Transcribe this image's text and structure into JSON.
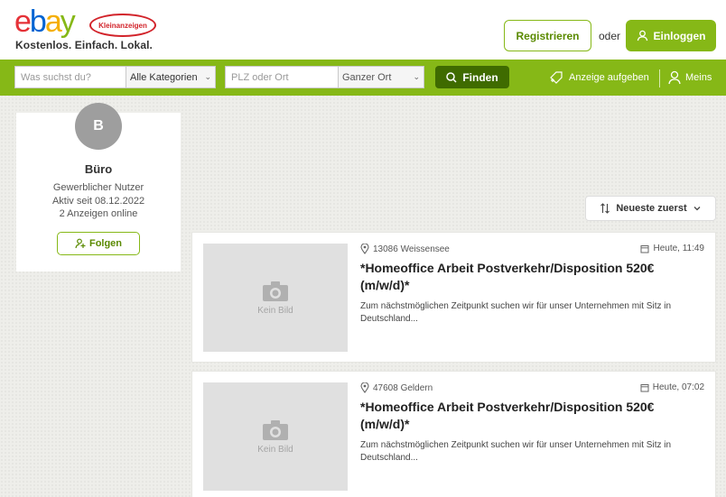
{
  "brand": {
    "logo_letters": [
      "e",
      "b",
      "a",
      "y"
    ],
    "badge": "Kleinanzeigen",
    "tagline": "Kostenlos. Einfach. Lokal.",
    "colors": {
      "accent": "#86b817",
      "accent_dark": "#3f6b00",
      "logo_red": "#e53238"
    }
  },
  "header": {
    "register_label": "Registrieren",
    "or_label": "oder",
    "login_label": "Einloggen"
  },
  "search": {
    "query_placeholder": "Was suchst du?",
    "category_value": "Alle Kategorien",
    "location_placeholder": "PLZ oder Ort",
    "radius_value": "Ganzer Ort",
    "find_label": "Finden",
    "post_ad_label": "Anzeige aufgeben",
    "mine_label": "Meins"
  },
  "profile": {
    "initial": "B",
    "name": "Büro",
    "type": "Gewerblicher Nutzer",
    "active_since": "Aktiv seit 08.12.2022",
    "ads_online": "2 Anzeigen online",
    "follow_label": "Folgen"
  },
  "sort": {
    "label": "Neueste zuerst"
  },
  "listings": [
    {
      "location": "13086 Weissensee",
      "date": "Heute, 11:49",
      "title": "*Homeoffice Arbeit Postverkehr/Disposition 520€ (m/w/d)*",
      "description": "Zum nächstmöglichen Zeitpunkt suchen wir für unser Unternehmen mit Sitz in Deutschland...",
      "no_image_label": "Kein Bild"
    },
    {
      "location": "47608 Geldern",
      "date": "Heute, 07:02",
      "title": "*Homeoffice Arbeit Postverkehr/Disposition 520€ (m/w/d)*",
      "description": "Zum nächstmöglichen Zeitpunkt suchen wir für unser Unternehmen mit Sitz in Deutschland...",
      "no_image_label": "Kein Bild"
    }
  ]
}
